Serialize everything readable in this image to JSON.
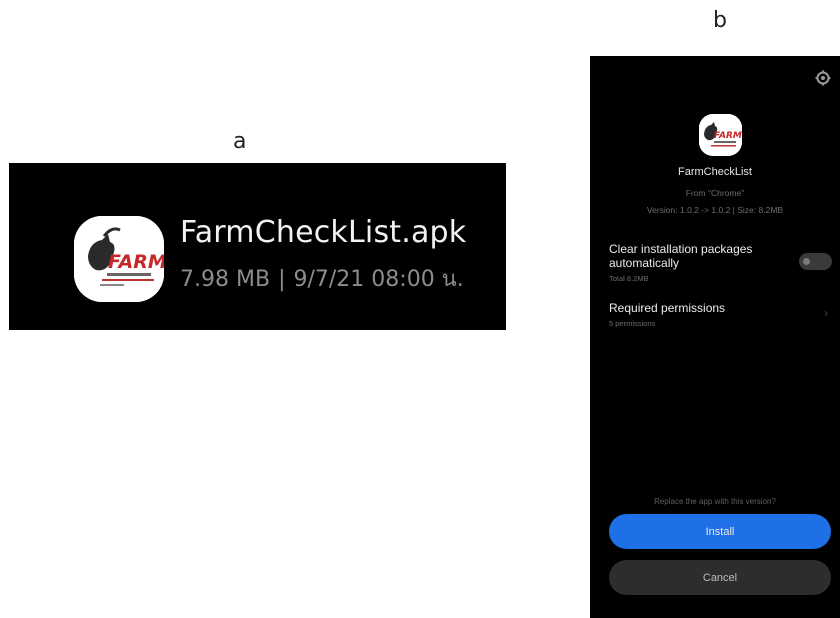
{
  "labels": {
    "a": "a",
    "b": "b"
  },
  "file_card": {
    "file_name": "FarmCheckList.apk",
    "size": "7.98 MB",
    "separator": "|",
    "date": "9/7/21 08:00 น.",
    "icon": {
      "name": "farm-logo-icon",
      "logo_text": "FARM"
    }
  },
  "installer": {
    "app_name": "FarmCheckList",
    "source": "From \"Chrome\"",
    "version": "Version: 1.0.2 -> 1.0.2 | Size: 8.2MB",
    "clear_packages": {
      "title_line1": "Clear installation packages",
      "title_line2": "automatically",
      "subtitle": "Total 8.2MB",
      "enabled": false
    },
    "permissions": {
      "title": "Required permissions",
      "subtitle": "5 permissions"
    },
    "replace_prompt": "Replace the app with this version?",
    "install_label": "Install",
    "cancel_label": "Cancel",
    "colors": {
      "accent": "#1f6fe6",
      "background": "#000000"
    },
    "icons": [
      "settings-icon",
      "chevron-right-icon",
      "farm-logo-icon"
    ]
  }
}
